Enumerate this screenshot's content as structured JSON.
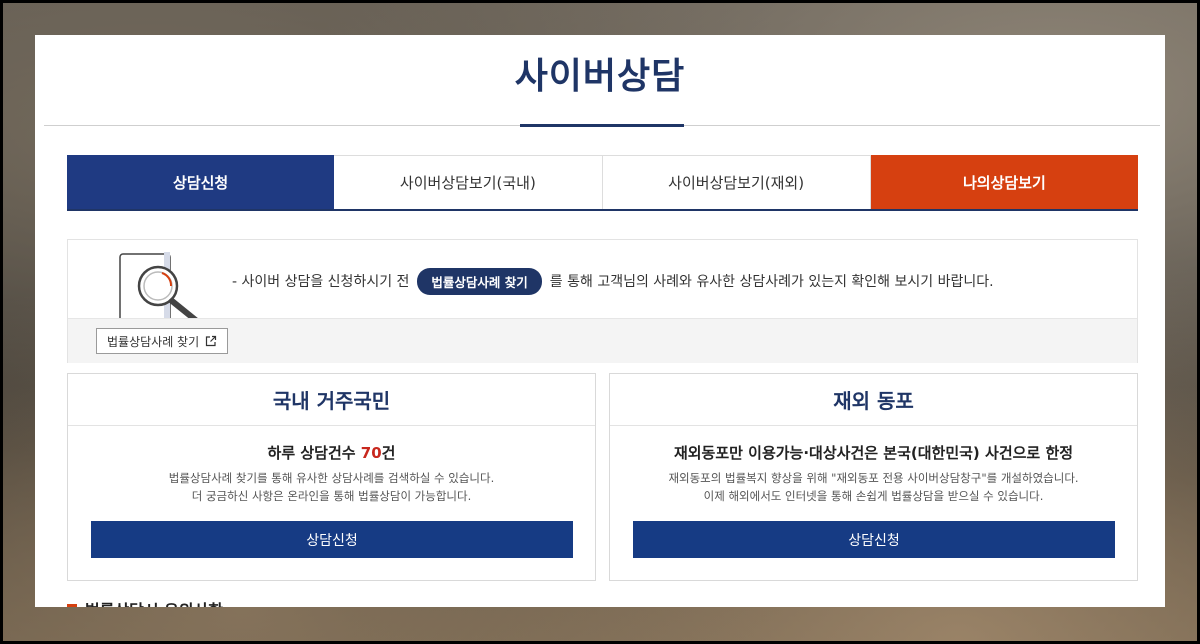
{
  "page": {
    "title": "사이버상담"
  },
  "tabs": [
    {
      "label": "상담신청",
      "state": "active"
    },
    {
      "label": "사이버상담보기(국내)",
      "state": "normal"
    },
    {
      "label": "사이버상담보기(재외)",
      "state": "normal"
    },
    {
      "label": "나의상담보기",
      "state": "highlight"
    }
  ],
  "notice": {
    "prefix": "- 사이버 상담을 신청하시기 전",
    "pill_label": "법률상담사례 찾기",
    "suffix": "를 통해 고객님의 사례와 유사한 상담사례가 있는지 확인해 보시기 바랍니다.",
    "button_label": "법률상담사례 찾기",
    "icons": [
      "document-search-icon",
      "external-link-icon"
    ]
  },
  "cards": {
    "domestic": {
      "title": "국내 거주국민",
      "headline_prefix": "하루 상담건수 ",
      "headline_count": "70",
      "headline_suffix": "건",
      "desc_line1": "법률상담사례 찾기를 통해 유사한 상담사례를 검색하실 수 있습니다.",
      "desc_line2": "더 궁금하신 사항은 온라인을 통해 법률상담이 가능합니다.",
      "button_label": "상담신청"
    },
    "overseas": {
      "title": "재외 동포",
      "headline": "재외동포만 이용가능·대상사건은 본국(대한민국) 사건으로 한정",
      "desc_line1": "재외동포의 법률복지 향상을 위해 \"재외동포 전용 사이버상담창구\"를 개설하였습니다.",
      "desc_line2": "이제 해외에서도 인터넷을 통해 손쉽게 법률상담을 받으실 수 있습니다.",
      "button_label": "상담신청"
    }
  },
  "section_peek": {
    "title": "법률상담시 유의사항"
  },
  "colors": {
    "navy": "#1f3566",
    "tab_active": "#1f3a82",
    "tab_highlight": "#d64010",
    "button": "#163b84",
    "count_red": "#c8281e"
  }
}
